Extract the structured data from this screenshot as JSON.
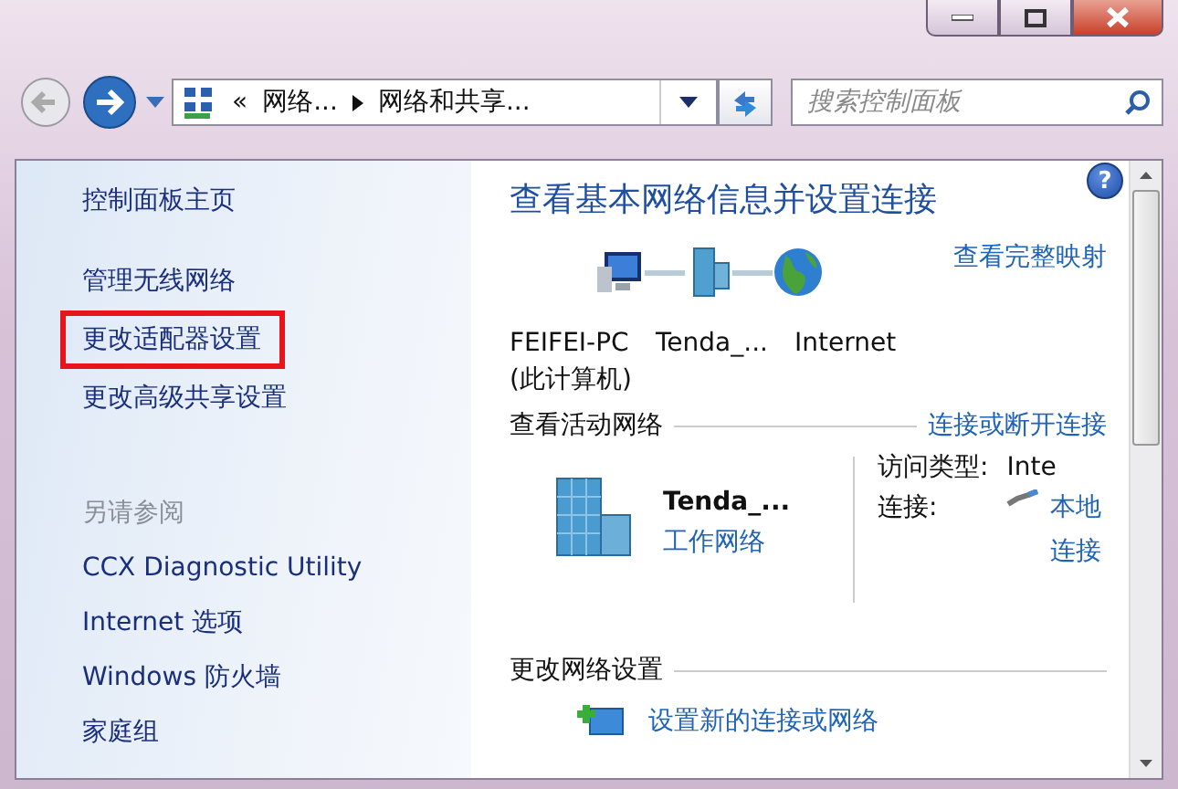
{
  "address_bar": {
    "overflow": "«",
    "crumbs": [
      "网络...",
      "网络和共享..."
    ]
  },
  "search": {
    "placeholder": "搜索控制面板"
  },
  "sidebar": {
    "items": [
      {
        "label": "控制面板主页",
        "highlighted": false
      },
      {
        "label": "管理无线网络",
        "highlighted": false
      },
      {
        "label": "更改适配器设置",
        "highlighted": true
      },
      {
        "label": "更改高级共享设置",
        "highlighted": false
      }
    ],
    "see_also": {
      "title": "另请参阅",
      "items": [
        "CCX Diagnostic Utility",
        "Internet 选项",
        "Windows 防火墙",
        "家庭组"
      ]
    }
  },
  "main": {
    "help": "?",
    "title": "查看基本网络信息并设置连接",
    "full_map_link": "查看完整映射",
    "map_nodes": [
      {
        "kind": "computer",
        "label": "FEIFEI-PC",
        "sublabel": "(此计算机)"
      },
      {
        "kind": "router",
        "label": "Tenda_..."
      },
      {
        "kind": "globe",
        "label": "Internet"
      }
    ],
    "active_networks": {
      "title": "查看活动网络",
      "link": "连接或断开连接",
      "network": {
        "name": "Tenda_...",
        "type": "工作网络",
        "access_label": "访问类型:",
        "access_value": "Inte",
        "connection_label": "连接:",
        "connection_value": "本地连接"
      }
    },
    "change_settings": {
      "title": "更改网络设置",
      "items": [
        "设置新的连接或网络"
      ]
    }
  }
}
